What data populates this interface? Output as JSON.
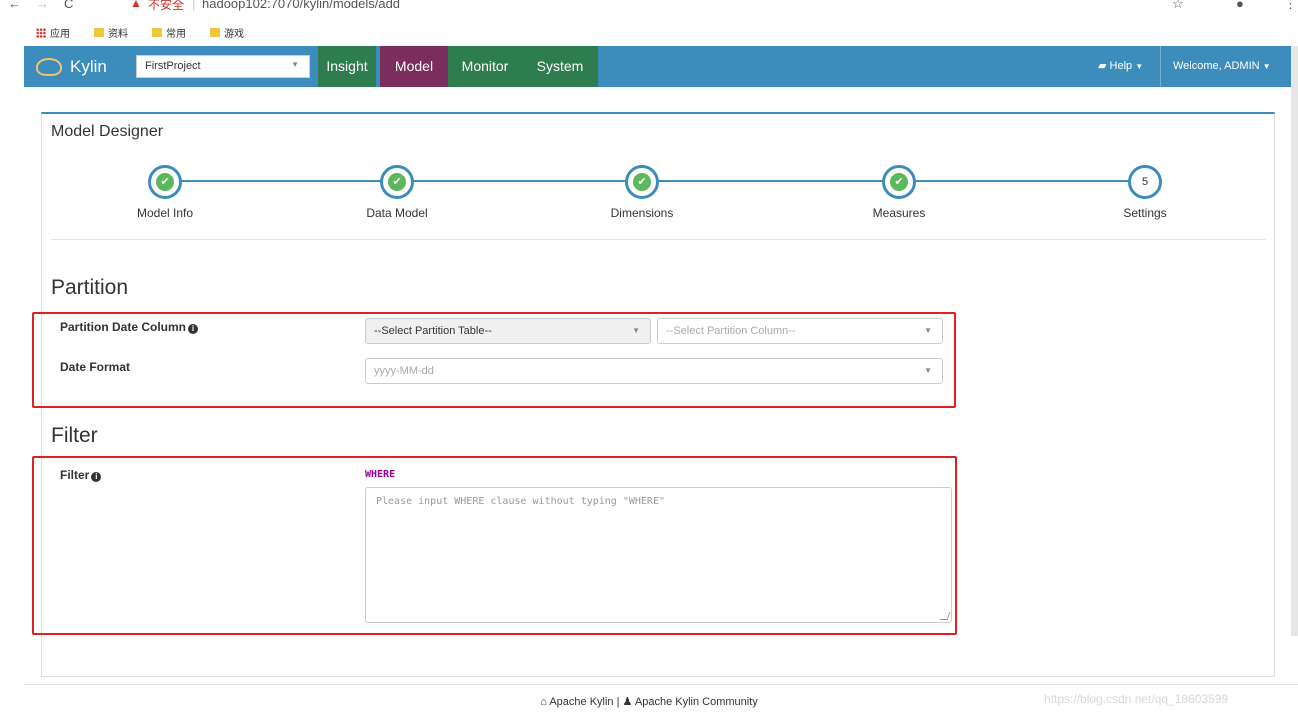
{
  "browser": {
    "address": "hadoop102:7070/kylin/models/add",
    "insecure_label": "不安全",
    "bookmarks": [
      {
        "label": "应用"
      },
      {
        "label": "资料"
      },
      {
        "label": "常用"
      },
      {
        "label": "游戏"
      }
    ]
  },
  "navbar": {
    "brand": "Kylin",
    "project": "FirstProject",
    "items": [
      "Insight",
      "Model",
      "Monitor",
      "System"
    ],
    "active_item": "Model",
    "help": "Help",
    "welcome": "Welcome, ADMIN"
  },
  "designer": {
    "title": "Model Designer",
    "steps": [
      {
        "label": "Model Info",
        "done": true
      },
      {
        "label": "Data Model",
        "done": true
      },
      {
        "label": "Dimensions",
        "done": true
      },
      {
        "label": "Measures",
        "done": true
      },
      {
        "label": "Settings",
        "done": false,
        "number": "5"
      }
    ]
  },
  "partition": {
    "title": "Partition",
    "date_column_label": "Partition Date Column",
    "table_select": "--Select Partition Table--",
    "column_select": "--Select Partition Column--",
    "date_format_label": "Date Format",
    "date_format_value": "yyyy-MM-dd"
  },
  "filter": {
    "title": "Filter",
    "label": "Filter",
    "keyword": "WHERE",
    "placeholder": "Please input WHERE clause without typing \"WHERE\""
  },
  "footer": {
    "text1": "Apache Kylin",
    "separator": "|",
    "text2": "Apache Kylin Community",
    "watermark": "https://blog.csdn.net/qq_18603599"
  },
  "colors": {
    "navbar": "#3c8dbc",
    "insight": "#2e7d4f",
    "model": "#7b2d5e",
    "monitor": "#2e7d4f",
    "system": "#2e7d4f",
    "step_check": "#5cb85c",
    "highlight": "#e02020"
  }
}
